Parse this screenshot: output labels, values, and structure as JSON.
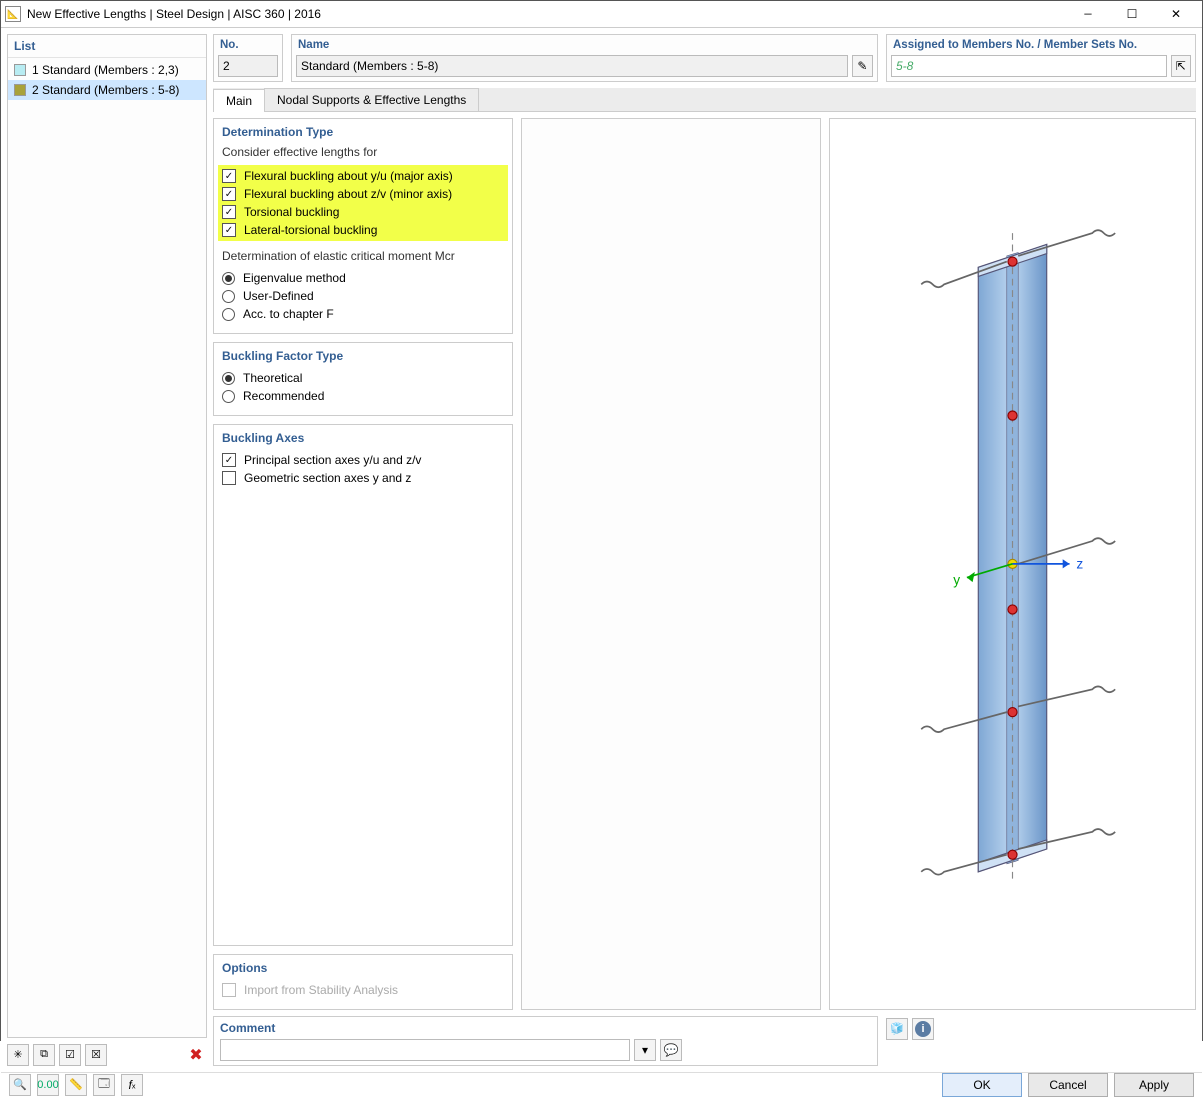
{
  "window": {
    "title": "New Effective Lengths | Steel Design | AISC 360 | 2016"
  },
  "list": {
    "header": "List",
    "items": [
      {
        "label": "1 Standard (Members : 2,3)",
        "color": "#b8ecf2",
        "selected": false
      },
      {
        "label": "2 Standard (Members : 5-8)",
        "color": "#a9a23a",
        "selected": true
      }
    ]
  },
  "fields": {
    "no_label": "No.",
    "no_value": "2",
    "name_label": "Name",
    "name_value": "Standard (Members : 5-8)",
    "assigned_label": "Assigned to Members No. / Member Sets No.",
    "assigned_value": "5-8"
  },
  "tabs": {
    "main": "Main",
    "nodal": "Nodal Supports & Effective Lengths"
  },
  "determination": {
    "title": "Determination Type",
    "consider_label": "Consider effective lengths for",
    "checks": [
      "Flexural buckling about y/u (major axis)",
      "Flexural buckling about z/v (minor axis)",
      "Torsional buckling",
      "Lateral-torsional buckling"
    ],
    "mcr_label": "Determination of elastic critical moment Mcr",
    "radios": [
      "Eigenvalue method",
      "User-Defined",
      "Acc. to chapter F"
    ]
  },
  "buckling_factor": {
    "title": "Buckling Factor Type",
    "radios": [
      "Theoretical",
      "Recommended"
    ]
  },
  "buckling_axes": {
    "title": "Buckling Axes",
    "checks": [
      {
        "label": "Principal section axes y/u and z/v",
        "checked": true
      },
      {
        "label": "Geometric section axes y and z",
        "checked": false
      }
    ]
  },
  "options": {
    "title": "Options",
    "import_label": "Import from Stability Analysis"
  },
  "comment": {
    "title": "Comment",
    "value": ""
  },
  "preview": {
    "y": "y",
    "z": "z"
  },
  "buttons": {
    "ok": "OK",
    "cancel": "Cancel",
    "apply": "Apply"
  }
}
